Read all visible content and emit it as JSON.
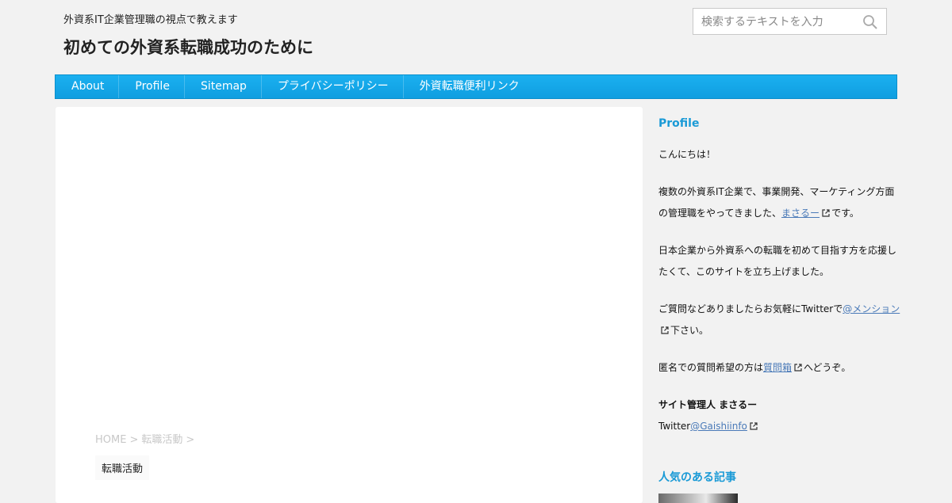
{
  "header": {
    "tagline": "外資系IT企業管理職の視点で教えます",
    "site_title": "初めての外資系転職成功のために",
    "search_placeholder": "検索するテキストを入力"
  },
  "nav": {
    "items": [
      "About",
      "Profile",
      "Sitemap",
      "プライバシーポリシー",
      "外資転職便利リンク"
    ]
  },
  "breadcrumb": {
    "home": "HOME",
    "category": "転職活動",
    "separator": ">"
  },
  "category_tag": "転職活動",
  "sidebar": {
    "profile_title": "Profile",
    "greeting": "こんにちは！",
    "p1_before": "複数の外資系IT企業で、事業開発、マーケティング方面の管理職をやってきました、",
    "p1_link": "まさるー",
    "p1_after": "です。",
    "p2": "日本企業から外資系への転職を初めて目指す方を応援したくて、このサイトを立ち上げました。",
    "p3_before": "ご質問などありましたらお気軽にTwitterで",
    "p3_link": "@メンション",
    "p3_after": "下さい。",
    "p4_before": "匿名での質問希望の方は",
    "p4_link": "質問箱",
    "p4_after": "へどうぞ。",
    "admin_label": "サイト管理人 まさるー",
    "twitter_label": "Twitter",
    "twitter_handle": "@Gaishiinfo",
    "popular_title": "人気のある記事"
  },
  "colors": {
    "accent": "#1a9ad6",
    "nav_bg": "#12a5e8",
    "link": "#4a7ab8",
    "page_bg": "#f2f2f2"
  },
  "icons": [
    "search-icon",
    "external-link-icon"
  ]
}
